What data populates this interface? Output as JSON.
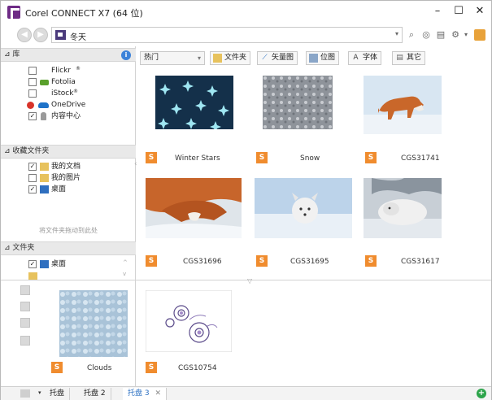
{
  "window": {
    "title": "Corel CONNECT X7 (64 位)",
    "controls": {
      "minimize": "–",
      "maximize": "☐",
      "close": "✕"
    }
  },
  "address_bar": {
    "back": "◀",
    "forward": "▶",
    "query": "冬天",
    "dropdown": "▾",
    "tools": {
      "search": "⌕",
      "tool2": "◎",
      "tool3": "▤",
      "settings": "⚙",
      "settings_arrow": "▾"
    }
  },
  "library": {
    "header": "库",
    "info": "i",
    "items": [
      {
        "label": "Flickr",
        "sup": "®",
        "checked": false
      },
      {
        "label": "Fotolia",
        "checked": false
      },
      {
        "label": "iStock",
        "sup": "®",
        "checked": false
      },
      {
        "label": "OneDrive",
        "checked": false
      },
      {
        "label": "内容中心",
        "checked": true
      }
    ]
  },
  "favorites": {
    "header": "收藏文件夹",
    "items": [
      {
        "label": "我的文档",
        "checked": true
      },
      {
        "label": "我的图片",
        "checked": false
      },
      {
        "label": "桌面",
        "checked": true
      }
    ],
    "hint": "将文件夹拖动到此处"
  },
  "folders": {
    "header": "文件夹",
    "items": [
      {
        "label": "桌面",
        "checked": true
      }
    ]
  },
  "toolbar": {
    "sort_label": "热门",
    "filters": [
      "文件夹",
      "矢量图",
      "位图",
      "字体",
      "其它"
    ]
  },
  "badge_letter": "S",
  "results": [
    {
      "caption": "Winter Stars",
      "type": "stars"
    },
    {
      "caption": "Snow",
      "type": "snow"
    },
    {
      "caption": "CGS31741",
      "type": "fox_standing"
    },
    {
      "caption": "CGS31696",
      "type": "fox_lying"
    },
    {
      "caption": "CGS31695",
      "type": "arctic_fox"
    },
    {
      "caption": "CGS31617",
      "type": "fox_curled"
    }
  ],
  "tray": {
    "items": [
      {
        "caption": "Clouds",
        "type": "clouds"
      },
      {
        "caption": "CGS10754",
        "type": "flowers"
      }
    ]
  },
  "bottom_tabs": {
    "menu_arrow": "▾",
    "tabs": [
      {
        "label": "托盘",
        "active": false
      },
      {
        "label": "托盘 2",
        "active": false
      },
      {
        "label": "托盘 3",
        "active": true,
        "close": "✕"
      }
    ],
    "add": "+"
  },
  "colors": {
    "accent": "#2a6fc2",
    "badge": "#f08c2e",
    "brand": "#6e2b86",
    "add_tray": "#2ca44a"
  }
}
